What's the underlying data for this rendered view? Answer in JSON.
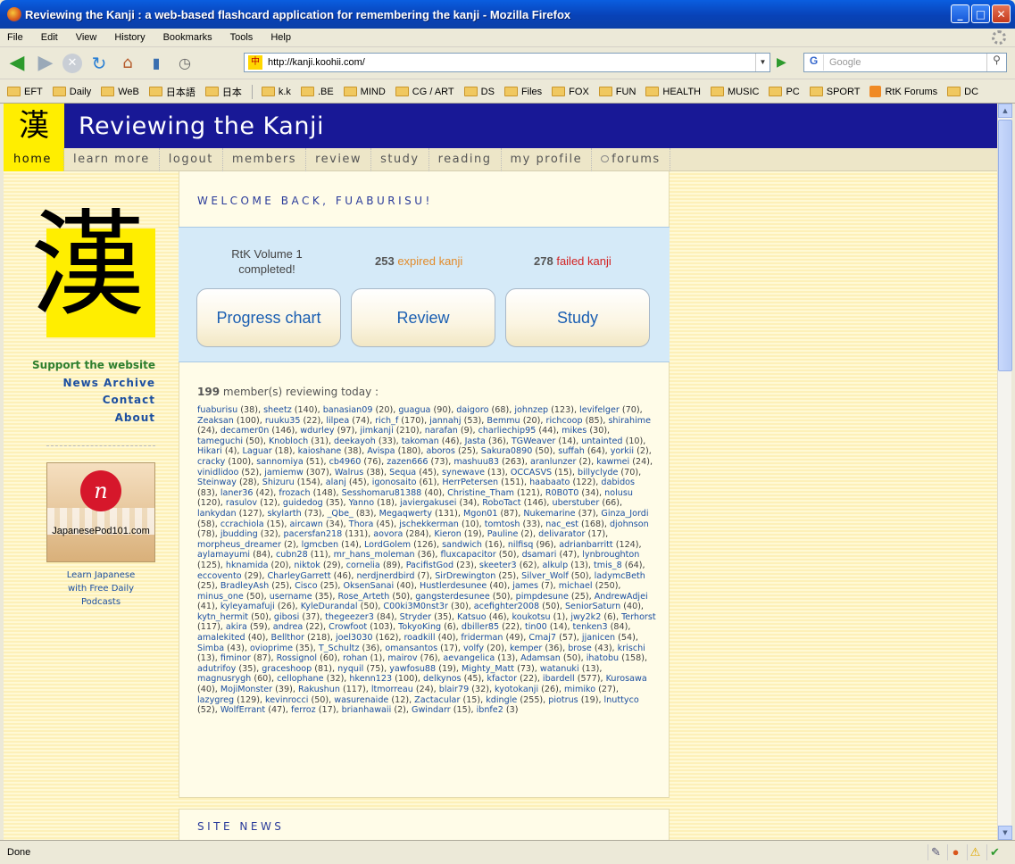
{
  "window": {
    "title": "Reviewing the Kanji : a web-based flashcard application for remembering the kanji - Mozilla Firefox",
    "btn_min": "_",
    "btn_max": "□",
    "btn_close": "✕"
  },
  "menubar": [
    "File",
    "Edit",
    "View",
    "History",
    "Bookmarks",
    "Tools",
    "Help"
  ],
  "urlbar": {
    "favicon": "中",
    "url": "http://kanji.koohii.com/"
  },
  "search": {
    "engine": "G",
    "placeholder": "Google"
  },
  "bookmarks": [
    {
      "label": "EFT",
      "type": "folder"
    },
    {
      "label": "Daily",
      "type": "folder"
    },
    {
      "label": "WeB",
      "type": "folder"
    },
    {
      "label": "日本語",
      "type": "folder"
    },
    {
      "label": "日本",
      "type": "folder"
    },
    {
      "label": "",
      "type": "sep"
    },
    {
      "label": "k.k",
      "type": "folder"
    },
    {
      "label": ".BE",
      "type": "folder"
    },
    {
      "label": "MIND",
      "type": "folder"
    },
    {
      "label": "CG / ART",
      "type": "folder"
    },
    {
      "label": "DS",
      "type": "folder"
    },
    {
      "label": "Files",
      "type": "folder"
    },
    {
      "label": "FOX",
      "type": "folder"
    },
    {
      "label": "FUN",
      "type": "folder"
    },
    {
      "label": "HEALTH",
      "type": "folder"
    },
    {
      "label": "MUSIC",
      "type": "folder"
    },
    {
      "label": "PC",
      "type": "folder"
    },
    {
      "label": "SPORT",
      "type": "folder"
    },
    {
      "label": "RtK Forums",
      "type": "rss"
    },
    {
      "label": "DC",
      "type": "folder"
    }
  ],
  "site": {
    "logo_char": "漢",
    "title": "Reviewing the Kanji",
    "nav": [
      "home",
      "learn more",
      "logout",
      "members",
      "review",
      "study",
      "reading",
      "my profile",
      "forums"
    ]
  },
  "sidebar": {
    "big_kanji": "漢",
    "support": "Support the website",
    "links": [
      "News Archive",
      "Contact",
      "About"
    ],
    "promo_text": "JapanesePod101.com",
    "promo_logo": "n",
    "promo_caption": [
      "Learn Japanese",
      "with Free Daily",
      "Podcasts"
    ]
  },
  "welcome": {
    "title": "WELCOME BACK, FUABURISU!"
  },
  "stats": {
    "volume_line1": "RtK Volume 1",
    "volume_line2": "completed!",
    "expired_count": "253",
    "expired_label": "expired kanji",
    "failed_count": "278",
    "failed_label": "failed kanji"
  },
  "buttons": {
    "progress": "Progress chart",
    "review": "Review",
    "study": "Study"
  },
  "members": {
    "count": "199",
    "label": "member(s) reviewing today :",
    "list": [
      [
        "fuaburisu",
        "38"
      ],
      [
        "sheetz",
        "140"
      ],
      [
        "banasian09",
        "20"
      ],
      [
        "guagua",
        "90"
      ],
      [
        "daigoro",
        "68"
      ],
      [
        "johnzep",
        "123"
      ],
      [
        "levifelger",
        "70"
      ],
      [
        "Zeaksan",
        "100"
      ],
      [
        "ruuku35",
        "22"
      ],
      [
        "lilpea",
        "74"
      ],
      [
        "rich_f",
        "170"
      ],
      [
        "jannahj",
        "53"
      ],
      [
        "Bemmu",
        "20"
      ],
      [
        "richcoop",
        "85"
      ],
      [
        "shirahime",
        "24"
      ],
      [
        "decamer0n",
        "146"
      ],
      [
        "wdurley",
        "97"
      ],
      [
        "jimkanji",
        "210"
      ],
      [
        "narafan",
        "9"
      ],
      [
        "charliechip95",
        "44"
      ],
      [
        "mikes",
        "30"
      ],
      [
        "tameguchi",
        "50"
      ],
      [
        "Knobloch",
        "31"
      ],
      [
        "deekayoh",
        "33"
      ],
      [
        "takoman",
        "46"
      ],
      [
        "Jasta",
        "36"
      ],
      [
        "TGWeaver",
        "14"
      ],
      [
        "untainted",
        "10"
      ],
      [
        "Hikari",
        "4"
      ],
      [
        "Laguar",
        "18"
      ],
      [
        "kaioshane",
        "38"
      ],
      [
        "Avispa",
        "180"
      ],
      [
        "aboros",
        "25"
      ],
      [
        "Sakura0890",
        "50"
      ],
      [
        "suffah",
        "64"
      ],
      [
        "yorkii",
        "2"
      ],
      [
        "cracky",
        "100"
      ],
      [
        "sannomiya",
        "51"
      ],
      [
        "cb4960",
        "76"
      ],
      [
        "zazen666",
        "73"
      ],
      [
        "mashuu83",
        "263"
      ],
      [
        "aranlunzer",
        "2"
      ],
      [
        "kawmei",
        "24"
      ],
      [
        "vinidlidoo",
        "52"
      ],
      [
        "jamiemw",
        "307"
      ],
      [
        "Walrus",
        "38"
      ],
      [
        "Sequa",
        "45"
      ],
      [
        "synewave",
        "13"
      ],
      [
        "OCCASVS",
        "15"
      ],
      [
        "billyclyde",
        "70"
      ],
      [
        "Steinway",
        "28"
      ],
      [
        "Shizuru",
        "154"
      ],
      [
        "alanj",
        "45"
      ],
      [
        "igonosaito",
        "61"
      ],
      [
        "HerrPetersen",
        "151"
      ],
      [
        "haabaato",
        "122"
      ],
      [
        "dabidos",
        "83"
      ],
      [
        "laner36",
        "42"
      ],
      [
        "frozach",
        "148"
      ],
      [
        "Sesshomaru81388",
        "40"
      ],
      [
        "Christine_Tham",
        "121"
      ],
      [
        "R0B0T0",
        "34"
      ],
      [
        "nolusu",
        "120"
      ],
      [
        "rasulov",
        "12"
      ],
      [
        "guidedog",
        "35"
      ],
      [
        "Yanno",
        "18"
      ],
      [
        "javiergakusei",
        "34"
      ],
      [
        "RoboTact",
        "146"
      ],
      [
        "uberstuber",
        "66"
      ],
      [
        "lankydan",
        "127"
      ],
      [
        "skylarth",
        "73"
      ],
      [
        "_Qbe_",
        "83"
      ],
      [
        "Megaqwerty",
        "131"
      ],
      [
        "Mgon01",
        "87"
      ],
      [
        "Nukemarine",
        "37"
      ],
      [
        "Ginza_Jordi",
        "58"
      ],
      [
        "ccrachiola",
        "15"
      ],
      [
        "aircawn",
        "34"
      ],
      [
        "Thora",
        "45"
      ],
      [
        "jschekkerman",
        "10"
      ],
      [
        "tomtosh",
        "33"
      ],
      [
        "nac_est",
        "168"
      ],
      [
        "djohnson",
        "78"
      ],
      [
        "jbudding",
        "32"
      ],
      [
        "pacersfan218",
        "131"
      ],
      [
        "aovora",
        "284"
      ],
      [
        "Kieron",
        "19"
      ],
      [
        "Pauline",
        "2"
      ],
      [
        "delivarator",
        "17"
      ],
      [
        "morpheus_dreamer",
        "2"
      ],
      [
        "lgmcben",
        "14"
      ],
      [
        "LordGolem",
        "126"
      ],
      [
        "sandwich",
        "16"
      ],
      [
        "nilfisq",
        "96"
      ],
      [
        "adrianbarritt",
        "124"
      ],
      [
        "aylamayumi",
        "84"
      ],
      [
        "cubn28",
        "11"
      ],
      [
        "mr_hans_moleman",
        "36"
      ],
      [
        "fluxcapacitor",
        "50"
      ],
      [
        "dsamari",
        "47"
      ],
      [
        "lynbroughton",
        "125"
      ],
      [
        "hknamida",
        "20"
      ],
      [
        "niktok",
        "29"
      ],
      [
        "cornelia",
        "89"
      ],
      [
        "PacifistGod",
        "23"
      ],
      [
        "skeeter3",
        "62"
      ],
      [
        "alkulp",
        "13"
      ],
      [
        "tmis_8",
        "64"
      ],
      [
        "eccovento",
        "29"
      ],
      [
        "CharleyGarrett",
        "46"
      ],
      [
        "nerdjnerdbird",
        "7"
      ],
      [
        "SirDrewington",
        "25"
      ],
      [
        "Silver_Wolf",
        "50"
      ],
      [
        "ladymcBeth",
        "25"
      ],
      [
        "BradleyAsh",
        "25"
      ],
      [
        "Cisco",
        "25"
      ],
      [
        "OksenSanai",
        "40"
      ],
      [
        "Hustlerdesunee",
        "40"
      ],
      [
        "james",
        "7"
      ],
      [
        "michael",
        "250"
      ],
      [
        "minus_one",
        "50"
      ],
      [
        "username",
        "35"
      ],
      [
        "Rose_Arteth",
        "50"
      ],
      [
        "gangsterdesunee",
        "50"
      ],
      [
        "pimpdesune",
        "25"
      ],
      [
        "AndrewAdjei",
        "41"
      ],
      [
        "kyleyamafuji",
        "26"
      ],
      [
        "KyleDurandal",
        "50"
      ],
      [
        "C00ki3M0nst3r",
        "30"
      ],
      [
        "acefighter2008",
        "50"
      ],
      [
        "SeniorSaturn",
        "40"
      ],
      [
        "kytn_hermit",
        "50"
      ],
      [
        "gibosi",
        "37"
      ],
      [
        "thegeezer3",
        "84"
      ],
      [
        "Stryder",
        "35"
      ],
      [
        "Katsuo",
        "46"
      ],
      [
        "koukotsu",
        "1"
      ],
      [
        "jwy2k2",
        "6"
      ],
      [
        "Terhorst",
        "117"
      ],
      [
        "akira",
        "59"
      ],
      [
        "andrea",
        "22"
      ],
      [
        "Crowfoot",
        "103"
      ],
      [
        "TokyoKing",
        "6"
      ],
      [
        "dbiller85",
        "22"
      ],
      [
        "tin00",
        "14"
      ],
      [
        "tenken3",
        "84"
      ],
      [
        "amalekited",
        "40"
      ],
      [
        "Bellthor",
        "218"
      ],
      [
        "joel3030",
        "162"
      ],
      [
        "roadkill",
        "40"
      ],
      [
        "friderman",
        "49"
      ],
      [
        "Cmaj7",
        "57"
      ],
      [
        "jjanicen",
        "54"
      ],
      [
        "Simba",
        "43"
      ],
      [
        "ovioprime",
        "35"
      ],
      [
        "T_Schultz",
        "36"
      ],
      [
        "omansantos",
        "17"
      ],
      [
        "volfy",
        "20"
      ],
      [
        "kemper",
        "36"
      ],
      [
        "brose",
        "43"
      ],
      [
        "krischi",
        "13"
      ],
      [
        "fiminor",
        "87"
      ],
      [
        "Rossignol",
        "60"
      ],
      [
        "rohan",
        "1"
      ],
      [
        "mairov",
        "76"
      ],
      [
        "aevangelica",
        "13"
      ],
      [
        "Adamsan",
        "50"
      ],
      [
        "ihatobu",
        "158"
      ],
      [
        "adutrifoy",
        "35"
      ],
      [
        "graceshoop",
        "81"
      ],
      [
        "nyquil",
        "75"
      ],
      [
        "yawfosu88",
        "19"
      ],
      [
        "Mighty_Matt",
        "73"
      ],
      [
        "watanuki",
        "13"
      ],
      [
        "magnusrygh",
        "60"
      ],
      [
        "cellophane",
        "32"
      ],
      [
        "hkenn123",
        "100"
      ],
      [
        "delkynos",
        "45"
      ],
      [
        "kfactor",
        "22"
      ],
      [
        "ibardell",
        "577"
      ],
      [
        "Kurosawa",
        "40"
      ],
      [
        "MojiMonster",
        "39"
      ],
      [
        "Rakushun",
        "117"
      ],
      [
        "ltmorreau",
        "24"
      ],
      [
        "blair79",
        "32"
      ],
      [
        "kyotokanji",
        "26"
      ],
      [
        "mimiko",
        "27"
      ],
      [
        "lazygreg",
        "129"
      ],
      [
        "kevinrocci",
        "50"
      ],
      [
        "wasurenaide",
        "12"
      ],
      [
        "Zactacular",
        "15"
      ],
      [
        "kdingle",
        "255"
      ],
      [
        "piotrus",
        "19"
      ],
      [
        "lnuttyco",
        "52"
      ],
      [
        "WolfErrant",
        "47"
      ],
      [
        "ferroz",
        "17"
      ],
      [
        "brianhawaii",
        "2"
      ],
      [
        "Gwindarr",
        "15"
      ],
      [
        "ibnfe2",
        "3"
      ]
    ]
  },
  "news": {
    "title": "SITE NEWS"
  },
  "statusbar": {
    "text": "Done"
  }
}
